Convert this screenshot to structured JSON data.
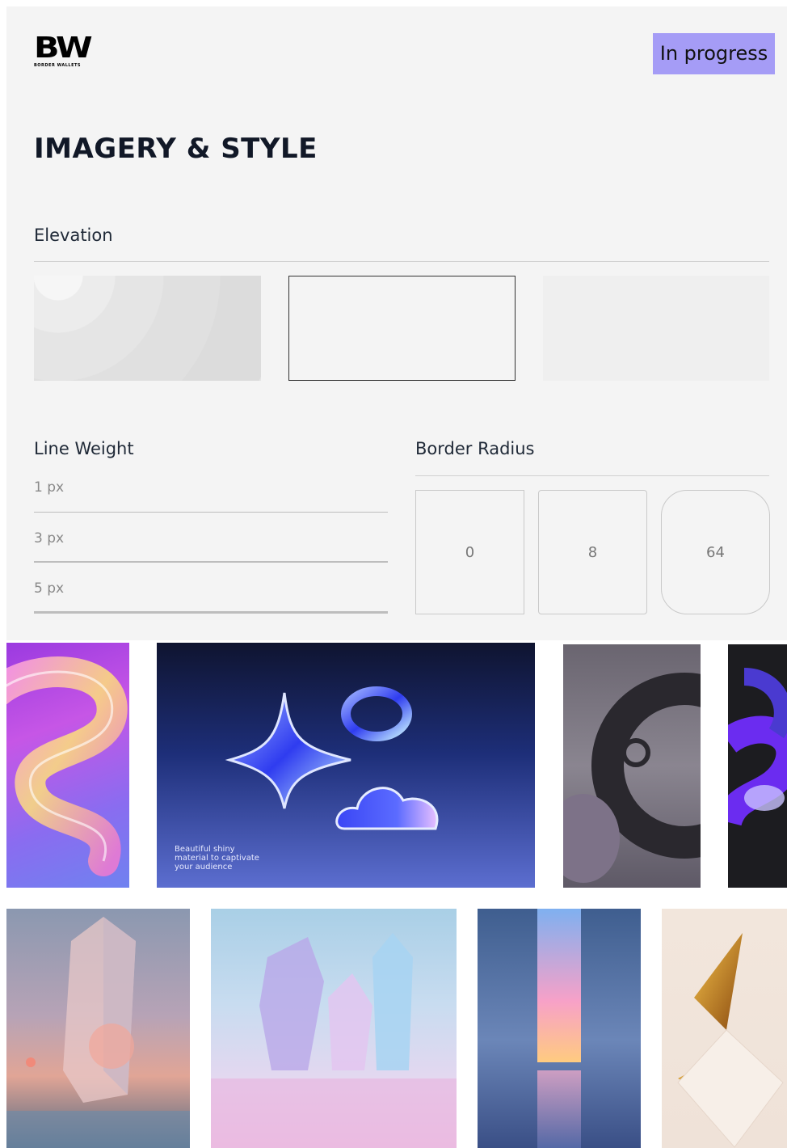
{
  "header": {
    "logo_mark": "BW",
    "logo_sub": "BORDER WALLETS",
    "status_badge": "In progress",
    "page_title": "IMAGERY & STYLE"
  },
  "elevation": {
    "heading": "Elevation"
  },
  "line_weight": {
    "heading": "Line Weight",
    "items": [
      {
        "label": "1 px"
      },
      {
        "label": "3 px"
      },
      {
        "label": "5 px"
      }
    ]
  },
  "border_radius": {
    "heading": "Border Radius",
    "items": [
      {
        "label": "0"
      },
      {
        "label": "8"
      },
      {
        "label": "64"
      }
    ]
  },
  "gallery": {
    "card_caption": "Beautiful shiny\nmaterial to captivate\nyour audience"
  },
  "colors": {
    "badge": "#a59cf6",
    "panel": "#f4f4f4",
    "text": "#111827"
  }
}
